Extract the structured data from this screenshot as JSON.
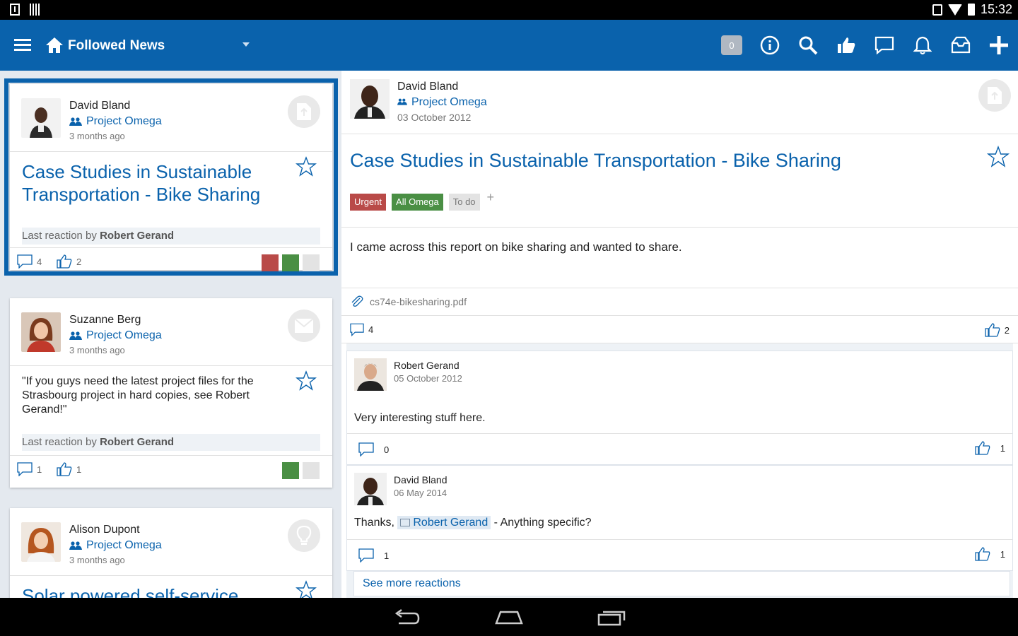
{
  "status_bar": {
    "time": "15:32"
  },
  "app_bar": {
    "title": "Followed News",
    "notification_count": "0",
    "actions": [
      "info-icon",
      "search-icon",
      "thumbs-up-icon",
      "chat-icon",
      "bell-icon",
      "inbox-icon",
      "plus-icon"
    ]
  },
  "feed": [
    {
      "author": "David Bland",
      "project": "Project Omega",
      "time": "3 months ago",
      "type_icon": "document-icon",
      "title": "Case Studies in Sustainable Transportation - Bike Sharing",
      "last_reaction_prefix": "Last reaction by",
      "last_reaction_name": "Robert Gerand",
      "comments": "4",
      "likes": "2",
      "tag_colors": [
        "#b94a48",
        "#4a8f44",
        "#e3e3e3"
      ]
    },
    {
      "author": "Suzanne Berg",
      "project": "Project Omega",
      "time": "3 months ago",
      "type_icon": "mail-icon",
      "title": "\"If you guys need the latest project files for the Strasbourg project in hard copies, see Robert Gerand!\"",
      "last_reaction_prefix": "Last reaction by",
      "last_reaction_name": "Robert Gerand",
      "comments": "1",
      "likes": "1",
      "tag_colors": [
        "#4a8f44",
        "#e3e3e3"
      ]
    },
    {
      "author": "Alison Dupont",
      "project": "Project Omega",
      "time": "3 months ago",
      "type_icon": "lightbulb-icon",
      "title": "Solar powered self-service"
    }
  ],
  "detail": {
    "author": "David Bland",
    "project": "Project Omega",
    "date": "03 October 2012",
    "title": "Case Studies in Sustainable Transportation - Bike Sharing",
    "tags": [
      {
        "label": "Urgent",
        "color": "#b94a48"
      },
      {
        "label": "All Omega",
        "color": "#4a8f44"
      },
      {
        "label": "To do",
        "color": "#e3e3e3"
      }
    ],
    "add_tag": "+",
    "body": "I came across this report on bike sharing and wanted to share.",
    "attachment": "cs74e-bikesharing.pdf",
    "comments": "4",
    "likes": "2",
    "reactions": [
      {
        "author": "Robert Gerand",
        "date": "05 October 2012",
        "text": "Very interesting stuff here.",
        "comments": "0",
        "likes": "1"
      },
      {
        "author": "David Bland",
        "date": "06 May 2014",
        "text_prefix": "Thanks,",
        "mention": "Robert Gerand",
        "text_suffix": "- Anything specific?",
        "comments": "1",
        "likes": "1"
      }
    ],
    "see_more": "See more reactions"
  },
  "colors": {
    "primary": "#0a62ac",
    "background": "#e4e9ef"
  }
}
